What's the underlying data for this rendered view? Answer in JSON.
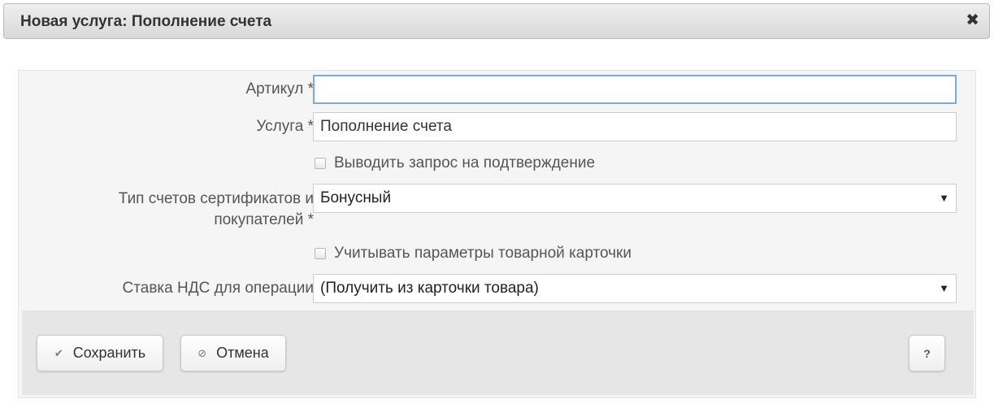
{
  "dialog": {
    "title": "Новая услуга: Пополнение счета",
    "close_glyph": "✖"
  },
  "form": {
    "article": {
      "label": "Артикул *",
      "value": ""
    },
    "service": {
      "label": "Услуга *",
      "value": "Пополнение счета"
    },
    "confirm_checkbox": {
      "label": "Выводить запрос на подтверждение",
      "checked": false
    },
    "account_type": {
      "label_line1": "Тип счетов сертификатов и",
      "label_line2": "покупателей *",
      "selected": "Бонусный"
    },
    "card_params_checkbox": {
      "label": "Учитывать параметры товарной карточки",
      "checked": false
    },
    "vat_rate": {
      "label": "Ставка НДС для операции",
      "selected": "(Получить из карточки товара)"
    },
    "caret_glyph": "▼"
  },
  "footer": {
    "save": {
      "label": "Сохранить",
      "icon": "check-icon",
      "glyph": "✔"
    },
    "cancel": {
      "label": "Отмена",
      "icon": "ban-icon",
      "glyph": "⊘"
    },
    "help": {
      "label": "?"
    }
  },
  "colors": {
    "focus_border": "#7fa7e0",
    "footer_bg": "#e6e6e6",
    "form_bg": "#f5f5f5"
  }
}
